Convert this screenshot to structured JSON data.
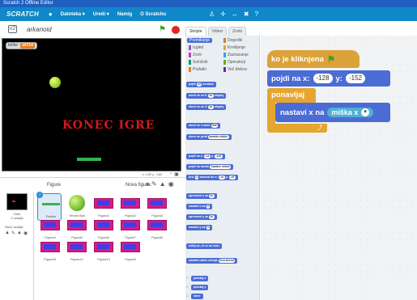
{
  "window": {
    "title": "Scratch 2 Offline Editor"
  },
  "menubar": {
    "logo": "SCRATCH",
    "items": [
      "Datoteka ▾",
      "Uredi ▾",
      "Namig",
      "O Scratchu"
    ],
    "tools": [
      "♙",
      "✛",
      "↔",
      "✖",
      "?"
    ]
  },
  "stage_header": {
    "project_name": "arkanoid",
    "version_badge": "v2"
  },
  "stage": {
    "variable_label": "točke",
    "variable_value": "10714",
    "game_over_text": "KONEC IGRE",
    "coords": "x: 240  y: -180"
  },
  "sprites_panel": {
    "title": "Figure",
    "new_sprite_label": "Nova figura:",
    "stage_label": "Oder",
    "stage_sub": "2 ozadja",
    "new_backdrop_label": "Novo ozadje:",
    "sprites": [
      {
        "name": "Paddle",
        "kind": "paddle",
        "selected": true
      },
      {
        "name": "Tennis Ball",
        "kind": "ball",
        "selected": false
      },
      {
        "name": "Figura1",
        "kind": "brick",
        "selected": false
      },
      {
        "name": "Figura2",
        "kind": "brick",
        "selected": false
      },
      {
        "name": "Figura3",
        "kind": "brick",
        "selected": false
      },
      {
        "name": "Figura4",
        "kind": "brick",
        "selected": false
      },
      {
        "name": "Figura5",
        "kind": "brick",
        "selected": false
      },
      {
        "name": "Figura6",
        "kind": "brick",
        "selected": false
      },
      {
        "name": "Figura7",
        "kind": "brick",
        "selected": false
      },
      {
        "name": "Figura8",
        "kind": "brick",
        "selected": false
      },
      {
        "name": "Figura11",
        "kind": "brick",
        "selected": false
      },
      {
        "name": "Figura12",
        "kind": "brick",
        "selected": false
      },
      {
        "name": "Figura13",
        "kind": "brick",
        "selected": false
      },
      {
        "name": "Figura9",
        "kind": "brick",
        "selected": false
      }
    ]
  },
  "tabs": {
    "scripts": "Skripte",
    "costumes": "Videzi",
    "sounds": "Zvoki"
  },
  "categories": {
    "motion": "Premikanje",
    "looks": "Izgled",
    "sound": "Zvok",
    "pen": "Svinčnik",
    "data": "Podatki",
    "events": "Dogodki",
    "control": "Krmiljenje",
    "sensing": "Zaznavanje",
    "operators": "Operatorji",
    "more": "Več blokov"
  },
  "palette_blocks": {
    "move": "pojdi",
    "move_steps": "10",
    "move_suffix": "korakov",
    "turn_right": "obrni se za ↻",
    "turn_right_val": "15",
    "turn_right_suffix": "stopinj",
    "turn_left": "obrni se za ↺",
    "turn_left_val": "15",
    "turn_left_suffix": "stopinj",
    "point_dir": "obrni se v smer",
    "point_dir_val": "90▾",
    "point_towards": "obrni se proti",
    "point_towards_val": "kazalec miške",
    "goto_xy": "pojdi na x:",
    "goto_x_val": "-14",
    "goto_y_label": "y:",
    "goto_y_val": "-152",
    "goto_sprite": "pojdi na mesto",
    "goto_sprite_val": "kazalec miške",
    "glide": "drsi",
    "glide_val": "1",
    "glide_mid": "sekund do x:",
    "glide_x": "-14",
    "glide_y_label": "y:",
    "glide_y": "-15",
    "change_x": "spremeni x za",
    "change_x_val": "10",
    "set_x": "nastavi x na",
    "set_x_val": "0",
    "change_y": "spremeni y za",
    "change_y_val": "10",
    "set_y": "nastavi y na",
    "set_y_val": "0",
    "bounce": "odbij se, če si na robu",
    "rotation_style": "nastavi način vrtenja",
    "rotation_style_val": "levo-desno",
    "xpos": "položaj x",
    "ypos": "položaj y",
    "direction": "smer"
  },
  "script": {
    "hat_label": "ko je kliknjena",
    "goto_label": "pojdi na x:",
    "goto_x": "-128",
    "goto_y_label": "y:",
    "goto_y": "-152",
    "forever_label": "ponavljaj",
    "forever_arrow": "⤴",
    "set_x_label": "nastavi x na",
    "sensor_label": "miška x",
    "sensor_dropdown": "▾"
  },
  "colors": {
    "motion": "#4a6cd4",
    "control": "#e6a52f",
    "events": "#dba23a",
    "sensing": "#4fb0d4",
    "stage_bg": "#000000",
    "game_over": "#d7181b",
    "menubar": "#0f87c9"
  }
}
